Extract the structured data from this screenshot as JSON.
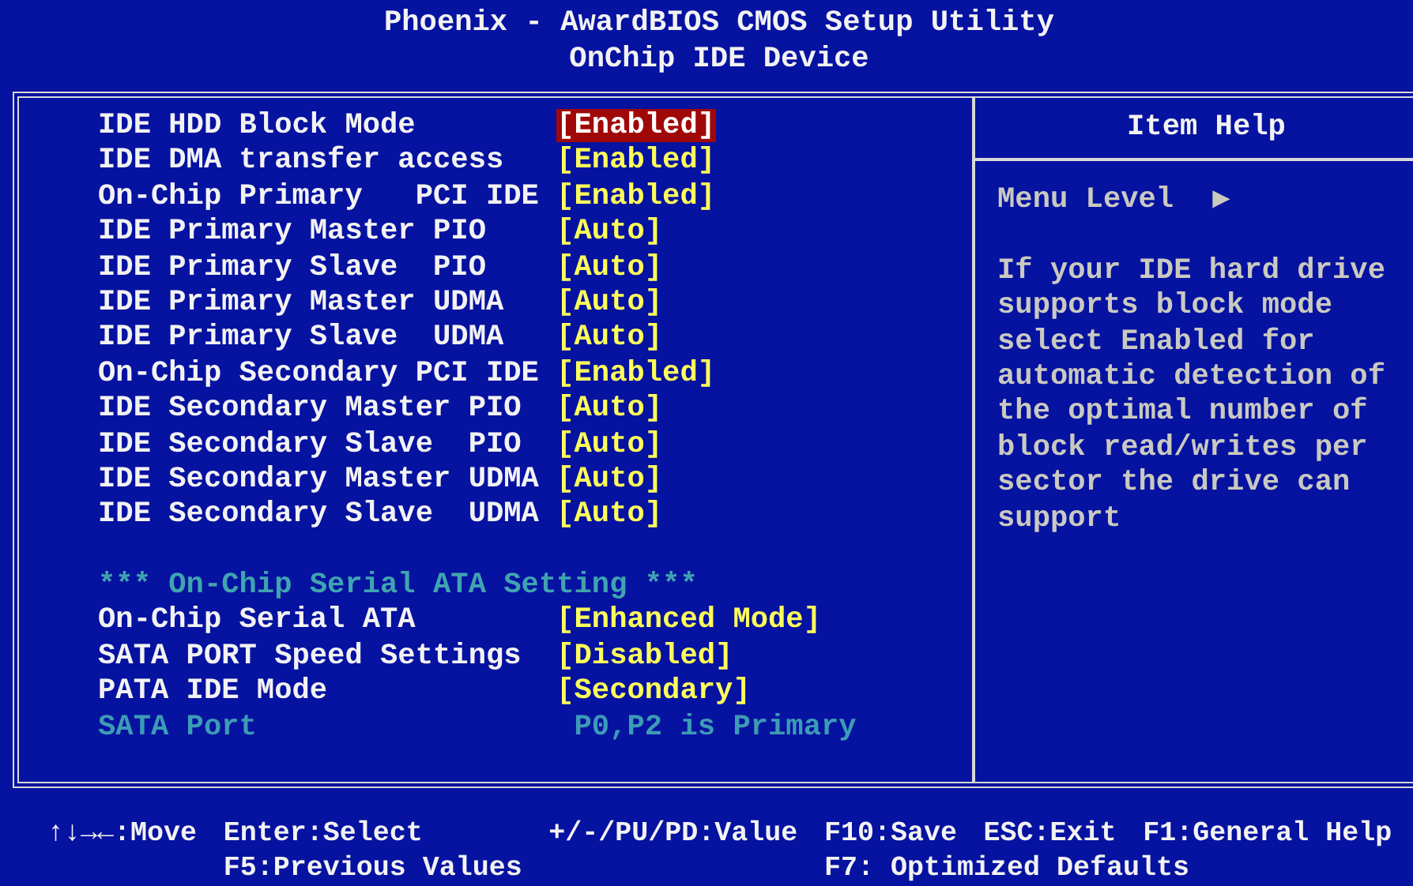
{
  "header": {
    "title": "Phoenix - AwardBIOS CMOS Setup Utility",
    "subtitle": "OnChip IDE Device"
  },
  "settings": [
    {
      "kind": "setting",
      "label": "IDE HDD Block Mode",
      "value": "[Enabled]",
      "selected": true
    },
    {
      "kind": "setting",
      "label": "IDE DMA transfer access",
      "value": "[Enabled]",
      "selected": false
    },
    {
      "kind": "setting",
      "label": "On-Chip Primary   PCI IDE",
      "value": "[Enabled]",
      "selected": false
    },
    {
      "kind": "setting",
      "label": "IDE Primary Master PIO",
      "value": "[Auto]",
      "selected": false
    },
    {
      "kind": "setting",
      "label": "IDE Primary Slave  PIO",
      "value": "[Auto]",
      "selected": false
    },
    {
      "kind": "setting",
      "label": "IDE Primary Master UDMA",
      "value": "[Auto]",
      "selected": false
    },
    {
      "kind": "setting",
      "label": "IDE Primary Slave  UDMA",
      "value": "[Auto]",
      "selected": false
    },
    {
      "kind": "setting",
      "label": "On-Chip Secondary PCI IDE",
      "value": "[Enabled]",
      "selected": false
    },
    {
      "kind": "setting",
      "label": "IDE Secondary Master PIO",
      "value": "[Auto]",
      "selected": false
    },
    {
      "kind": "setting",
      "label": "IDE Secondary Slave  PIO",
      "value": "[Auto]",
      "selected": false
    },
    {
      "kind": "setting",
      "label": "IDE Secondary Master UDMA",
      "value": "[Auto]",
      "selected": false
    },
    {
      "kind": "setting",
      "label": "IDE Secondary Slave  UDMA",
      "value": "[Auto]",
      "selected": false
    },
    {
      "kind": "blank"
    },
    {
      "kind": "section",
      "label": "*** On-Chip Serial ATA Setting ***"
    },
    {
      "kind": "setting",
      "label": "On-Chip Serial ATA",
      "value": "[Enhanced Mode]",
      "selected": false
    },
    {
      "kind": "setting",
      "label": "SATA PORT Speed Settings",
      "value": "[Disabled]",
      "selected": false
    },
    {
      "kind": "setting",
      "label": "PATA IDE Mode",
      "value": "[Secondary]",
      "selected": false
    },
    {
      "kind": "readonly",
      "label": "SATA Port",
      "value": "P0,P2 is Primary",
      "disabled": true
    }
  ],
  "help": {
    "title": "Item Help",
    "menu_level": "Menu Level",
    "menu_marker": "▶",
    "text": "If your IDE hard drive supports block mode select Enabled for automatic detection of the optimal number of block read/writes per sector the drive can support"
  },
  "footer": {
    "line_1": [
      "↑↓→←:Move",
      "Enter:Select",
      "+/-/PU/PD:Value",
      "F10:Save",
      "ESC:Exit",
      "F1:General Help"
    ],
    "line_2": [
      "F5:Previous Values",
      "F7: Optimized Defaults"
    ]
  }
}
